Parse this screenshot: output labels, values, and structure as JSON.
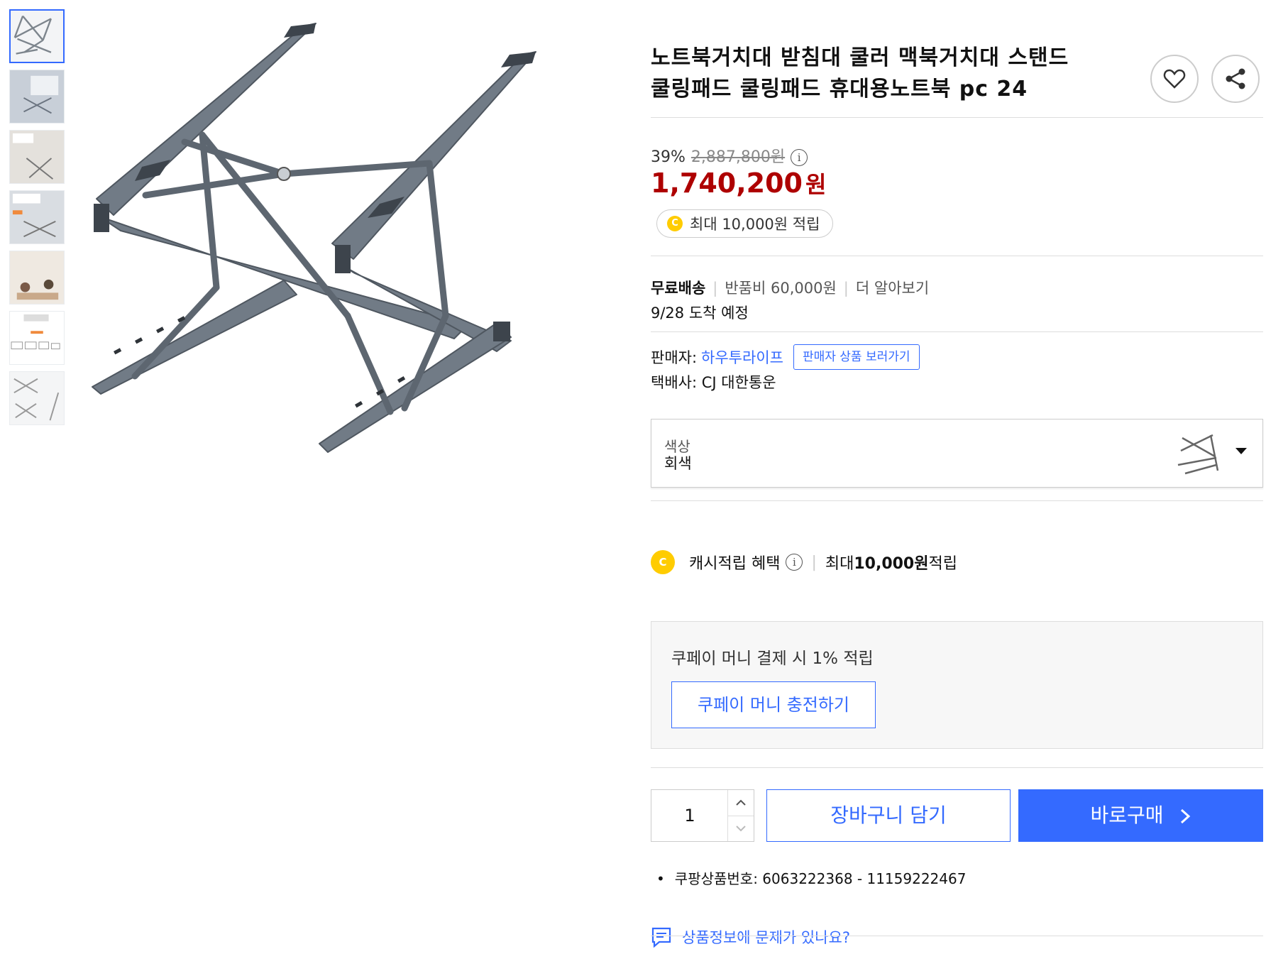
{
  "thumbnails": [
    {
      "name": "thumb-stand",
      "active": true
    },
    {
      "name": "thumb-laptop",
      "active": false
    },
    {
      "name": "thumb-foldable",
      "active": false
    },
    {
      "name": "thumb-double-triangle",
      "active": false
    },
    {
      "name": "thumb-people",
      "active": false
    },
    {
      "name": "thumb-compatible",
      "active": false
    },
    {
      "name": "thumb-parts",
      "active": false
    }
  ],
  "product": {
    "title_line1": "노트북거치대 받침대 쿨러 맥북거치대 스탠드",
    "title_line2": "쿨링패드 쿨링패드 휴대용노트북 pc 24",
    "discount_rate": "39%",
    "original_price": "2,887,800원",
    "price": "1,740,200",
    "price_unit": "원",
    "cash_badge": "최대 10,000원 적립",
    "coin_letter": "C"
  },
  "shipping": {
    "free_label": "무료배송",
    "return_fee": "반품비 60,000원",
    "learn_more": "더 알아보기",
    "arrival": "9/28 도착 예정"
  },
  "seller": {
    "label": "판매자:",
    "name": "하우투라이프",
    "view_products": "판매자 상품 보러가기",
    "courier_label": "택배사:",
    "courier": "CJ 대한통운"
  },
  "option": {
    "label": "색상",
    "value": "회색"
  },
  "cash_benefit": {
    "label": "캐시적립 혜택",
    "detail_prefix": "최대 ",
    "detail_amount": "10,000원",
    "detail_suffix": " 적립"
  },
  "coupay": {
    "text": "쿠페이 머니 결제 시 1% 적립",
    "charge_button": "쿠페이 머니 충전하기"
  },
  "purchase": {
    "quantity": "1",
    "cart_button": "장바구니 담기",
    "buy_button": "바로구매"
  },
  "product_id": "쿠팡상품번호: 6063222368 - 11159222467",
  "report_link": "상품정보에 문제가 있나요?",
  "colors": {
    "accent": "#346aff",
    "price": "#ae0000",
    "coin": "#ffcc00"
  },
  "icons": [
    "heart-icon",
    "share-icon",
    "info-icon",
    "coin-icon",
    "chevron-down-icon",
    "chevron-up-icon",
    "chevron-right-icon",
    "caret-down-icon",
    "chat-icon"
  ]
}
